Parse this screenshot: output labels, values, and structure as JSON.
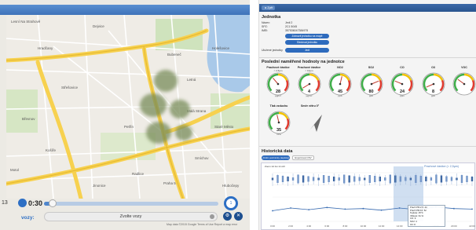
{
  "player": {
    "time_prefix": "13",
    "time": "0:30",
    "speed": "1",
    "progress": 0.05,
    "vehicles_label": "vozy:",
    "vehicle_select": "Zvolte vozy",
    "attribution": "Map data ©2015 Google   Terms of Use   Report a map error"
  },
  "map": {
    "labels": [
      "Lesní Na Strahově",
      "Dejvice",
      "Bubeneč",
      "Holešovice",
      "Letná",
      "Hradčany",
      "Střešovice",
      "Břevnov",
      "Malá Strana",
      "Smíchov",
      "Košíře",
      "Motol",
      "Petřín",
      "Radlice",
      "Jinonice",
      "Staré Město",
      "Praha 5",
      "Hlubočepy"
    ]
  },
  "detail": {
    "back_label": "◄ Zpět",
    "unit_title": "Jednotka",
    "unit_fields": [
      {
        "k": "Název:",
        "v": "Jedi 2"
      },
      {
        "k": "SPZ:",
        "v": "2C1 5045"
      },
      {
        "k": "IMEI:",
        "v": "357536047384975"
      }
    ],
    "pill_1": "Zobrazit jednotku na mapě",
    "pill_2": "Sledovat jednotku",
    "state_label": "Uložené jednotky",
    "state_pill": "Jedi",
    "section_title": "Poslední naměřené hodnoty na jednotce",
    "compass_label": "Směr větru 0°",
    "history_title": "Historická data",
    "history_select": "Jízdní podmínky (teplota)",
    "history_button": "Exportovat CSV",
    "chart_zoom": "Zoom  1d  1w  1m  All",
    "chart_title": "Prachové částice (< 2,5µm)",
    "tooltip": [
      "Prach PM 2,5: 44",
      "Prach PM 10: 52",
      "Teplota: 15°C",
      "Vlhkost: 61 %",
      "CO: 9",
      "NO2: 4",
      "O3: 8"
    ]
  },
  "gauges": [
    {
      "title": "Prachové částice",
      "sub": "< 2,5µm",
      "value": "28",
      "unit": "µg/m³",
      "needle": 0.35
    },
    {
      "title": "Prachové částice",
      "sub": "< 10µm",
      "value": "4",
      "unit": "µg/m³",
      "needle": 0.05
    },
    {
      "title": "NO2",
      "sub": "",
      "value": "45",
      "unit": "ppb",
      "needle": 0.55
    },
    {
      "title": "SO2",
      "sub": "",
      "value": "80",
      "unit": "ppb",
      "needle": 0.75
    },
    {
      "title": "CO",
      "sub": "",
      "value": "24",
      "unit": "ppm",
      "needle": 0.25
    },
    {
      "title": "O3",
      "sub": "",
      "value": "8",
      "unit": "ppb",
      "needle": 0.08
    },
    {
      "title": "VOC",
      "sub": "",
      "value": "",
      "unit": "",
      "needle": 0.3
    }
  ],
  "temp_gauge": {
    "title": "Tlak vzduchu",
    "value": "35",
    "unit": "hPa",
    "needle": 0.45
  },
  "chart_data": {
    "type": "line",
    "title": "Prachové částice (< 2,5µm)",
    "x": [
      "0:00",
      "2:00",
      "4:00",
      "6:00",
      "8:00",
      "10:00",
      "12:00",
      "14:00",
      "16:00",
      "18:00",
      "20:00",
      "22:00"
    ],
    "series": [
      {
        "values": [
          42,
          47,
          44,
          48,
          45,
          46,
          43,
          47,
          44,
          49,
          46,
          45
        ]
      }
    ]
  },
  "colors": {
    "accent": "#2e6bbd",
    "road": "#f7d14f"
  }
}
